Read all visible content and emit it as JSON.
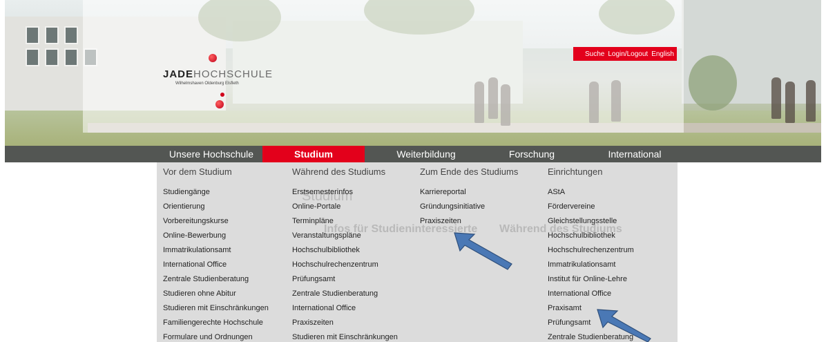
{
  "logo": {
    "name_bold": "JADE",
    "name_light": "HOCHSCHULE",
    "subtitle": "Wilhelmshaven Oldenburg Elsfleth"
  },
  "top_links": [
    "Suche",
    "Login/Logout",
    "English"
  ],
  "nav": {
    "items": [
      {
        "label": "Unsere Hochschule"
      },
      {
        "label": "Studium"
      },
      {
        "label": "Weiterbildung"
      },
      {
        "label": "Forschung"
      },
      {
        "label": "International"
      }
    ],
    "active": "Studium"
  },
  "menu": {
    "columns": [
      {
        "heading": "Vor dem Studium",
        "links": [
          "Studiengänge",
          "Orientierung",
          "Vorbereitungskurse",
          "Online-Bewerbung",
          "Immatrikulationsamt",
          "International Office",
          "Zentrale Studienberatung",
          "Studieren ohne Abitur",
          "Studieren mit Einschränkungen",
          "Familiengerechte Hochschule",
          "Formulare und Ordnungen"
        ]
      },
      {
        "heading": "Während des Studiums",
        "links": [
          "Erstsemesterinfos",
          "Online-Portale",
          "Terminpläne",
          "Veranstaltungspläne",
          "Hochschulbibliothek",
          "Hochschulrechenzentrum",
          "Prüfungsamt",
          "Zentrale Studienberatung",
          "International Office",
          "Praxiszeiten",
          "Studieren mit Einschränkungen"
        ]
      },
      {
        "heading": "Zum Ende des Studiums",
        "links": [
          "Karriereportal",
          "Gründungsinitiative",
          "Praxiszeiten"
        ]
      },
      {
        "heading": "Einrichtungen",
        "links": [
          "AStA",
          "Fördervereine",
          "Gleichstellungsstelle",
          "Hochschulbibliothek",
          "Hochschulrechenzentrum",
          "Immatrikulationsamt",
          "Institut für Online-Lehre",
          "International Office",
          "Praxisamt",
          "Prüfungsamt",
          "Zentrale Studienberatung"
        ]
      }
    ]
  },
  "background_text": {
    "page_title": "Studium",
    "section_left": "Infos für Studieninteressierte",
    "section_right": "Während des Studiums"
  },
  "colors": {
    "accent": "#e3001b",
    "nav_bg": "#535653",
    "arrow": "#4a78b5"
  }
}
